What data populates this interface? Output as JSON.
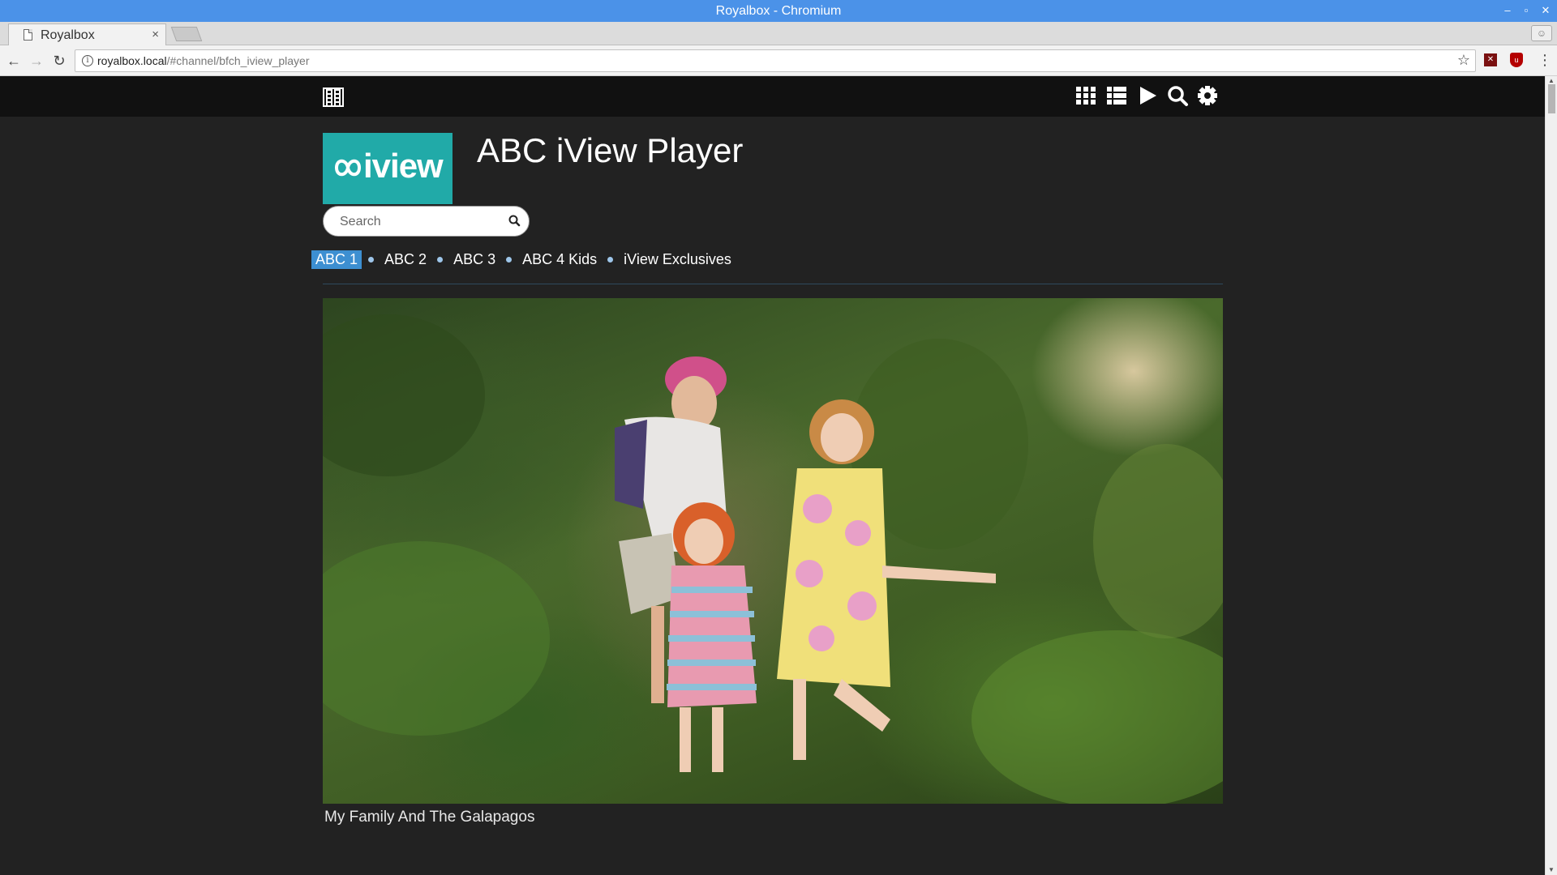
{
  "window": {
    "title": "Royalbox - Chromium",
    "minimize": "–",
    "maximize": "▫",
    "close": "✕"
  },
  "tabs": [
    {
      "label": "Royalbox",
      "close": "×"
    }
  ],
  "toolbar": {
    "back": "←",
    "forward": "→",
    "reload": "↻",
    "url_host": "royalbox.local",
    "url_path": "/#channel/bfch_iview_player",
    "bookmark": "☆",
    "menu": "⋮"
  },
  "site": {
    "logo_text": "iview",
    "page_title": "ABC iView Player",
    "search_placeholder": "Search",
    "nav_icons": [
      "film-icon",
      "grid-icon",
      "list-icon",
      "play-icon",
      "search-icon",
      "gear-icon"
    ]
  },
  "channels": [
    {
      "label": "ABC 1",
      "active": true
    },
    {
      "label": "ABC 2",
      "active": false
    },
    {
      "label": "ABC 3",
      "active": false
    },
    {
      "label": "ABC 4 Kids",
      "active": false
    },
    {
      "label": "iView Exclusives",
      "active": false
    }
  ],
  "featured": {
    "title": "My Family And The Galapagos"
  },
  "colors": {
    "titlebar": "#4b92e8",
    "page_bg": "#222222",
    "nav_bg": "#111111",
    "logo_bg": "#21aaa8",
    "active_channel": "#3d8fd1"
  }
}
